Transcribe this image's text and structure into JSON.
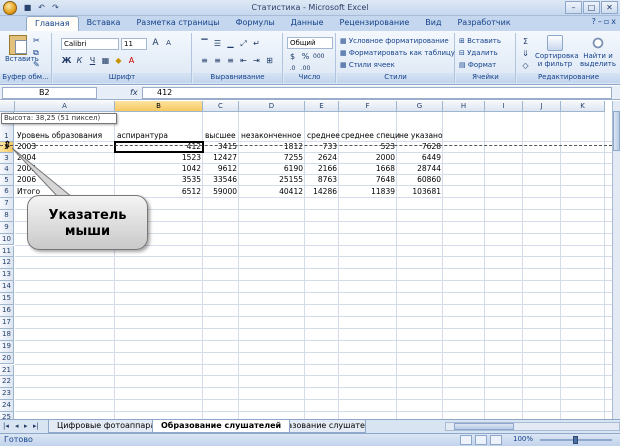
{
  "window": {
    "title": "Статистика - Microsoft Excel",
    "min": "–",
    "max": "□",
    "close": "✕"
  },
  "ribbon_tabs": [
    "Главная",
    "Вставка",
    "Разметка страницы",
    "Формулы",
    "Данные",
    "Рецензирование",
    "Вид",
    "Разработчик"
  ],
  "ribbon": {
    "clipboard": {
      "paste": "Вставить",
      "label": "Буфер обм..."
    },
    "font": {
      "name": "Calibri",
      "size": "11",
      "bold": "Ж",
      "italic": "К",
      "underline": "Ч",
      "grow": "A",
      "shrink": "A",
      "label": "Шрифт"
    },
    "alignment": {
      "label": "Выравнивание"
    },
    "number": {
      "format": "Общий",
      "percent": "%",
      "thousands": "000",
      "currency": "$",
      "label": "Число"
    },
    "styles": {
      "conditional": "Условное форматирование",
      "as_table": "Форматировать как таблицу",
      "cell_styles": "Стили ячеек",
      "label": "Стили"
    },
    "cells": {
      "insert": "Вставить",
      "delete": "Удалить",
      "format": "Формат",
      "label": "Ячейки"
    },
    "editing": {
      "sum": "Σ",
      "sort": "Сортировка и фильтр",
      "find": "Найти и выделить",
      "label": "Редактирование"
    }
  },
  "formula_bar": {
    "name_box": "B2",
    "fx": "fx",
    "value": "412"
  },
  "columns": [
    "A",
    "B",
    "C",
    "D",
    "E",
    "F",
    "G",
    "H",
    "I",
    "J",
    "K"
  ],
  "rows": [
    "1",
    "2",
    "3",
    "4",
    "5",
    "6",
    "7",
    "8",
    "9",
    "10",
    "11",
    "12",
    "13",
    "14",
    "15",
    "16",
    "17",
    "18",
    "19",
    "20",
    "21",
    "22",
    "23",
    "24",
    "25"
  ],
  "table": {
    "headers": [
      "Уровень образования",
      "аспирантура",
      "высшее",
      "незаконченное",
      "среднее",
      "среднее специ",
      "не указано"
    ],
    "data": [
      [
        "2003",
        "412",
        "3415",
        "1812",
        "733",
        "523",
        "7628"
      ],
      [
        "2004",
        "1523",
        "12427",
        "7255",
        "2624",
        "2000",
        "6449"
      ],
      [
        "2005",
        "1042",
        "9612",
        "6190",
        "2166",
        "1668",
        "28744"
      ],
      [
        "2006",
        "3535",
        "33546",
        "25155",
        "8763",
        "7648",
        "60860"
      ],
      [
        "Итого",
        "6512",
        "59000",
        "40412",
        "14286",
        "11839",
        "103681"
      ]
    ]
  },
  "tooltip": "Высота: 38,25 (51 пиксел)",
  "callout": {
    "line1": "Указатель",
    "line2": "мыши"
  },
  "sheets": [
    "Цифровые фотоаппараты",
    "Образование слушателей",
    "Образование слушателей"
  ],
  "status": {
    "ready": "Готово",
    "zoom": "100%"
  }
}
